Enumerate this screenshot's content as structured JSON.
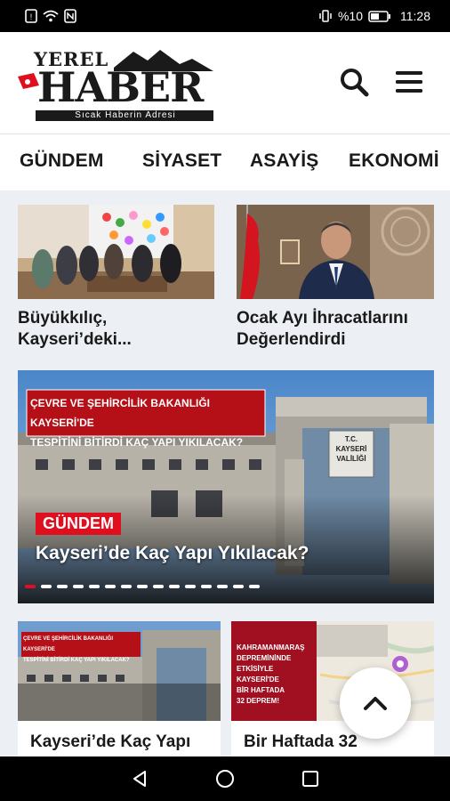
{
  "status": {
    "battery": "%10",
    "time": "11:28"
  },
  "header": {
    "logo_top": "YEREL",
    "logo_main": "HABER",
    "logo_tagline": "Sıcak Haberin Adresi"
  },
  "nav": {
    "items": [
      "GÜNDEM",
      "SİYASET",
      "ASAYİŞ",
      "EKONOMİ"
    ]
  },
  "cards": [
    {
      "title_line1": "Büyükkılıç,",
      "title_line2": "Kayseri’deki..."
    },
    {
      "title_line1": "Ocak Ayı İhracatlarını",
      "title_line2": "Değerlendirdi"
    }
  ],
  "slider": {
    "banner_line1": "ÇEVRE VE ŞEHİRCİLİK BAKANLIĞI KAYSERİ'DE",
    "banner_line2": "TESPİTİNİ BİTİRDİ KAÇ YAPI YIKILACAK?",
    "sign_line1": "T.C.",
    "sign_line2": "KAYSERİ",
    "sign_line3": "VALİLİĞİ",
    "category": "GÜNDEM",
    "title": "Kayseri’de Kaç Yapı Yıkılacak?",
    "dot_count": 15,
    "active_dot": 0
  },
  "bottom_cards": [
    {
      "banner_line1": "ÇEVRE VE ŞEHİRCİLİK BAKANLIĞI KAYSERİ'DE",
      "banner_line2": "TESPİTİNİ BİTİRDİ KAÇ YAPI YIKILACAK?",
      "title": "Kayseri’de Kaç Yapı"
    },
    {
      "overlay_lines": [
        "KAHRAMANMARAŞ",
        "DEPREMİNİNDE",
        "ETKİSİYLE",
        "KAYSERİ'DE",
        "BİR HAFTADA",
        "32 DEPREM!"
      ],
      "title": "Bir Haftada 32"
    }
  ],
  "colors": {
    "accent": "#e00f1f",
    "dark": "#1a1a1a",
    "background": "#eceff3"
  }
}
